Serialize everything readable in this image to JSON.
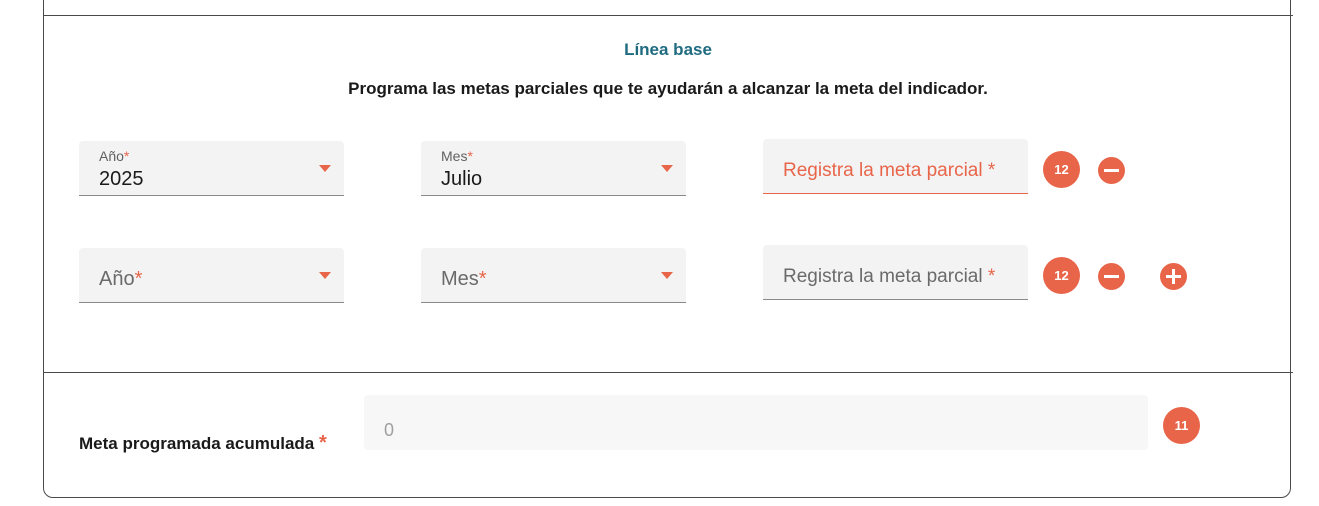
{
  "section": {
    "title": "Línea base",
    "instructions": "Programa las metas parciales que te ayudarán a alcanzar la meta del indicador."
  },
  "rows": [
    {
      "year": {
        "label": "Año",
        "required_mark": "*",
        "value": "2025"
      },
      "month": {
        "label": "Mes",
        "required_mark": "*",
        "value": "Julio"
      },
      "goal": {
        "placeholder": "Registra la meta parcial",
        "required_mark": "*",
        "state": "error"
      },
      "badge": "12"
    },
    {
      "year": {
        "label": "Año",
        "required_mark": "*",
        "value": ""
      },
      "month": {
        "label": "Mes",
        "required_mark": "*",
        "value": ""
      },
      "goal": {
        "placeholder": "Registra la meta parcial",
        "required_mark": "*",
        "state": "normal"
      },
      "badge": "12"
    }
  ],
  "accumulated": {
    "label": "Meta programada acumulada",
    "required_mark": "*",
    "value": "0",
    "badge": "11"
  },
  "colors": {
    "accent": "#e8654a",
    "title": "#1f6b80",
    "field_bg": "#f3f3f3"
  },
  "icons": {
    "remove": "minus-circle-icon",
    "add": "plus-circle-icon",
    "dropdown": "caret-down-icon"
  }
}
